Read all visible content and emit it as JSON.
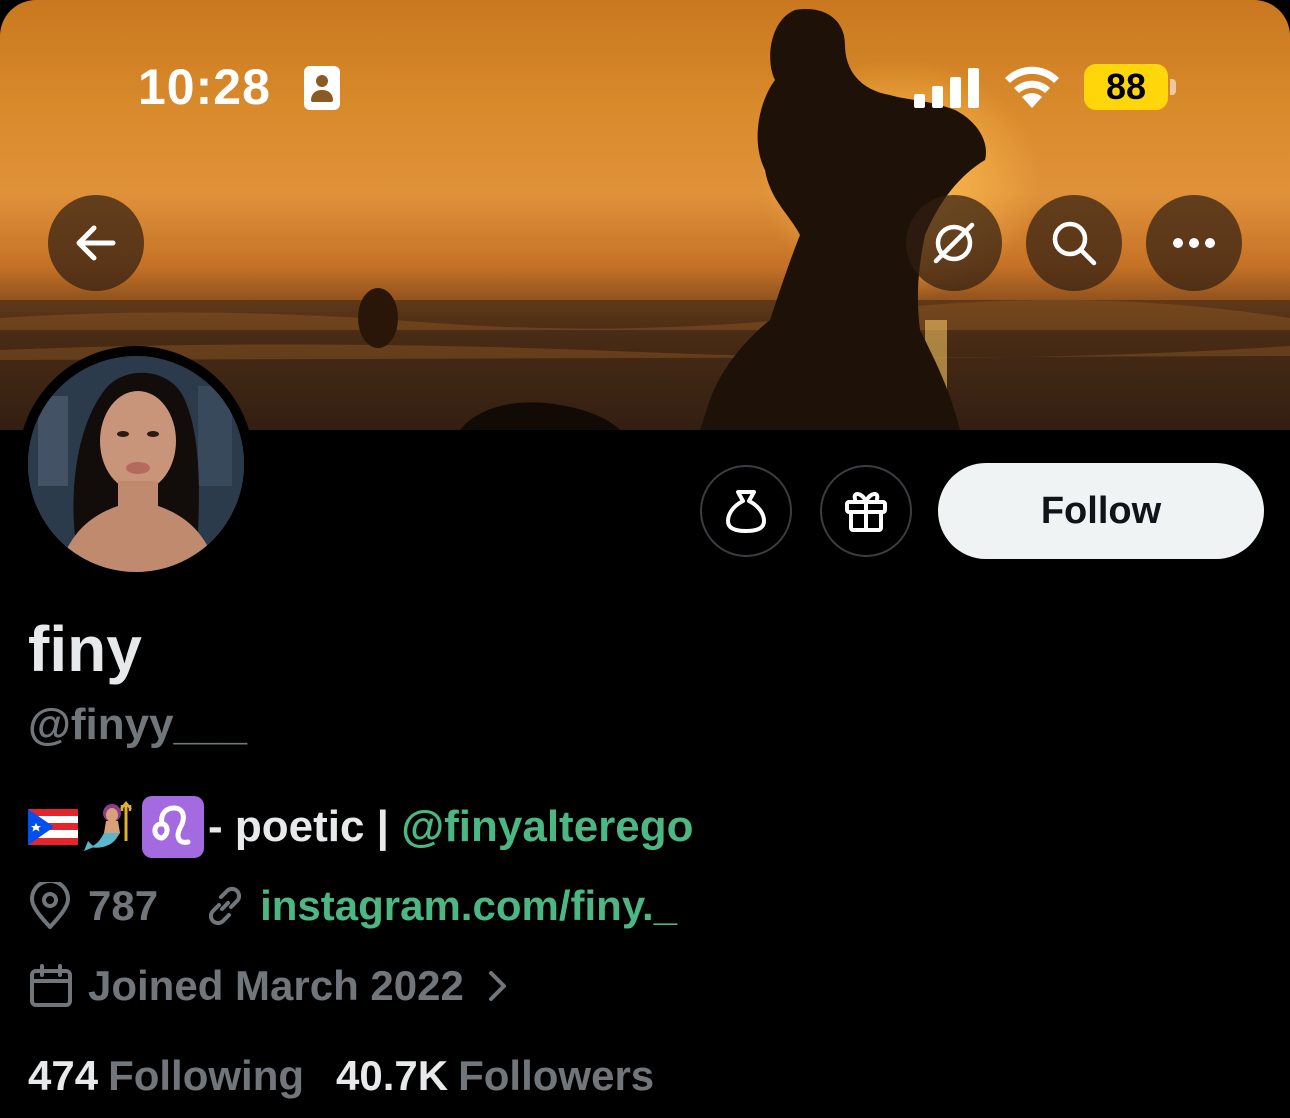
{
  "status_bar": {
    "time": "10:28",
    "battery": "88"
  },
  "banner": {
    "back_icon": "arrow-left-icon",
    "buttons": [
      "grok-icon",
      "search-icon",
      "more-icon"
    ]
  },
  "actions": {
    "icons": [
      "money-bag-icon",
      "gift-icon"
    ],
    "follow_label": "Follow"
  },
  "profile": {
    "display_name": "finy",
    "handle": "@finyy___",
    "bio_text": "- poetic | ",
    "bio_mention": "@finyalterego",
    "location": "787",
    "website": "instagram.com/finy._",
    "joined": "Joined March 2022",
    "following_count": "474",
    "following_label": "Following",
    "followers_count": "40.7K",
    "followers_label": "Followers"
  },
  "colors": {
    "link": "#4cb783",
    "secondary": "#71767b",
    "battery": "#ffd60a"
  }
}
